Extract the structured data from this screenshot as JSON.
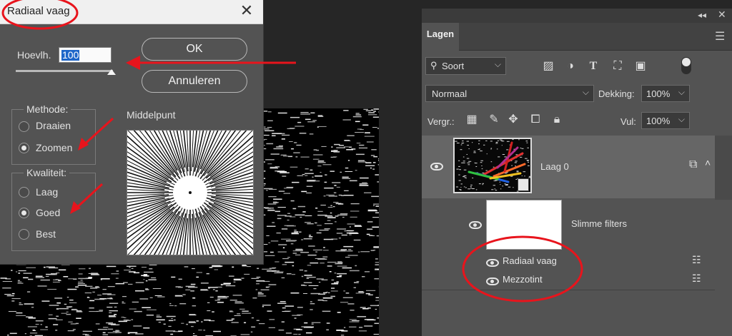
{
  "dialog": {
    "title": "Radiaal vaag",
    "amount_label": "Hoevlh.",
    "amount_value": "100",
    "amount_slider_level": 1.0,
    "ok": "OK",
    "cancel": "Annuleren",
    "method_title": "Methode:",
    "methods": [
      "Draaien",
      "Zoomen"
    ],
    "method_selected": "Zoomen",
    "quality_title": "Kwaliteit:",
    "qualities": [
      "Laag",
      "Goed",
      "Best"
    ],
    "quality_selected": "Goed",
    "center_label": "Middelpunt"
  },
  "panel": {
    "tab": "Lagen",
    "filter_kind": "Soort",
    "blend_mode": "Normaal",
    "opacity_label": "Dekking:",
    "opacity_value": "100%",
    "lock_label": "Vergr.:",
    "fill_label": "Vul:",
    "fill_value": "100%",
    "layer_name": "Laag 0",
    "smart_filters_label": "Slimme filters",
    "filters": [
      "Radiaal vaag",
      "Mezzotint"
    ]
  },
  "colors": {
    "annotation": "#e8141c",
    "dialog_bg": "#535353",
    "panel_bg": "#535353",
    "selection": "#1d66c9"
  }
}
